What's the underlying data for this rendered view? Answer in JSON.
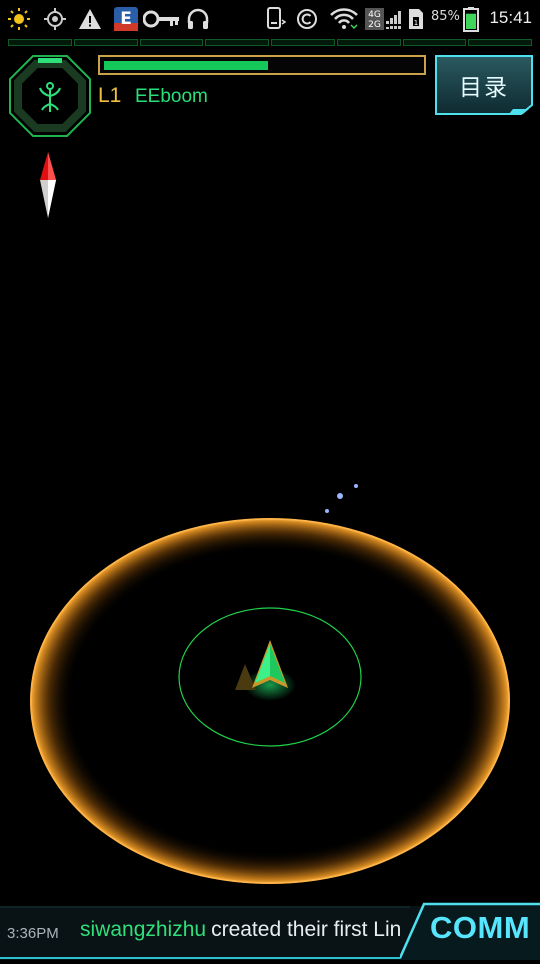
{
  "status_bar": {
    "icons": [
      "sun-icon",
      "gps-icon",
      "warning-icon",
      "app-notification-icon",
      "key-icon",
      "headphones-icon",
      "phone-vibrate-icon",
      "copyright-icon",
      "wifi-icon",
      "network-4g-2g-icon",
      "sim-icon",
      "battery-icon"
    ],
    "network_top": "4G",
    "network_bottom": "2G",
    "battery_percent": "85%",
    "battery_level": 0.85,
    "time": "15:41"
  },
  "header": {
    "xm_fill": 0.52,
    "level": "L1",
    "agent_name": "EEboom",
    "menu_button_label": "目录"
  },
  "faction_icon": "enlightened-icon",
  "comm": {
    "time": "3:36PM",
    "user": "siwangzhizhu",
    "message": "created their first Lin",
    "button_label": "COMM"
  },
  "colors": {
    "accent_green": "#27e07a",
    "level_gold": "#f0c040",
    "range_ring": "#e0902a",
    "comm_cyan": "#58e6ff"
  }
}
